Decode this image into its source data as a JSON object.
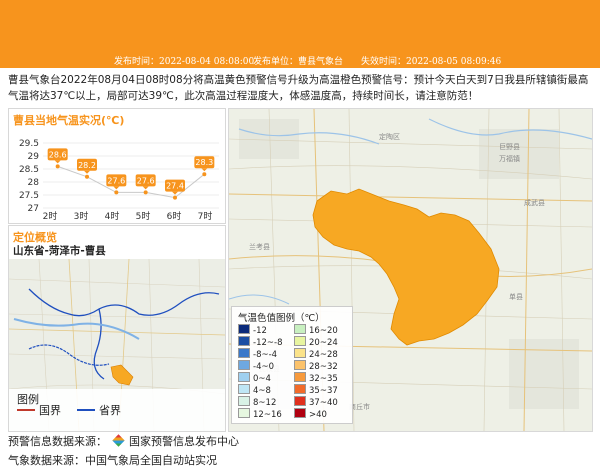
{
  "header": {
    "publish_time": "发布时间：2022-08-04 08:08:00",
    "publish_unit": "发布单位：曹县气象台",
    "expire_time": "失效时间：2022-08-05 08:09:46",
    "color": "#f7941d"
  },
  "description": "曹县气象台2022年08月04日08时08分将高温黄色预警信号升级为高温橙色预警信号：预计今天白天到7日我县所辖镇街最高气温将达37℃以上，局部可达39℃，此次高温过程湿度大，体感温度高，持续时间长，请注意防范！",
  "temp_panel": {
    "title": "曹县当地气温实况(℃)"
  },
  "chart_data": {
    "type": "line",
    "title": "曹县当地气温实况(℃)",
    "categories": [
      "2时",
      "3时",
      "4时",
      "5时",
      "6时",
      "7时"
    ],
    "values": [
      28.6,
      28.2,
      27.6,
      27.6,
      27.4,
      28.3
    ],
    "yticks": [
      "29.5",
      "29",
      "28.5",
      "28",
      "27.5",
      "27"
    ],
    "ylim": [
      27,
      29.5
    ],
    "grid": true,
    "label_color": "#f7941d"
  },
  "location_panel": {
    "title": "定位概览",
    "location": "山东省-菏泽市-曹县",
    "legend_title": "图例",
    "legend_items": [
      {
        "label": "国界",
        "color": "#c0392b"
      },
      {
        "label": "省界",
        "color": "#1f4fbf"
      }
    ]
  },
  "big_map": {
    "warning_area_color": "#f7a823",
    "place_labels": [
      "巨野县",
      "成武县",
      "单县",
      "定陶区",
      "兰考县",
      "商丘市",
      "民权县",
      "万福镇"
    ]
  },
  "temp_legend": {
    "title": "气温色值图例（℃）",
    "items": [
      {
        "label": "-12",
        "color": "#0b2a7a"
      },
      {
        "label": "16~20",
        "color": "#c8f0c0"
      },
      {
        "label": "-12~-8",
        "color": "#1b4ea3"
      },
      {
        "label": "20~24",
        "color": "#e8f5a0"
      },
      {
        "label": "-8~-4",
        "color": "#3a78c9"
      },
      {
        "label": "24~28",
        "color": "#fbe38a"
      },
      {
        "label": "-4~0",
        "color": "#6ea8e0"
      },
      {
        "label": "28~32",
        "color": "#fbc26b"
      },
      {
        "label": "0~4",
        "color": "#9fd0f0"
      },
      {
        "label": "32~35",
        "color": "#f79a3c"
      },
      {
        "label": "4~8",
        "color": "#bfe6f5"
      },
      {
        "label": "35~37",
        "color": "#f26b2a"
      },
      {
        "label": "8~12",
        "color": "#d9f2e6"
      },
      {
        "label": "37~40",
        "color": "#e0301e"
      },
      {
        "label": "12~16",
        "color": "#e6f7e0"
      },
      {
        "label": ">40",
        "color": "#b00010"
      }
    ]
  },
  "footer": {
    "warning_source_label": "预警信息数据来源：",
    "warning_source_name": "国家预警信息发布中心",
    "weather_source": "气象数据来源：中国气象局全国自动站实况"
  }
}
